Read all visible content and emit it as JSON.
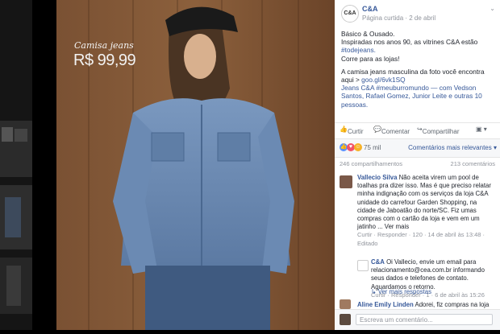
{
  "image_overlay": {
    "title": "Camisa jeans",
    "price": "R$ 99,99"
  },
  "post": {
    "page_name": "C&A",
    "page_logo_text": "C&A",
    "meta": "Página curtida · 2 de abril",
    "lines": [
      "Básico & Ousado.",
      "Inspiradas nos anos 90, as vitrines C&A estão",
      "#todejeans.",
      "Corre para as lojas!"
    ],
    "para2_prefix": "A camisa jeans masculina da foto você encontra",
    "para2_link_prefix": "aqui > ",
    "para2_link": "goo.gl/6vk1SQ",
    "tags_line1": "Jeans C&A #meuburromundo — com Vedson",
    "tags_line2": "Santos, Rafael Gomez, Junior Leite e outras 10",
    "tags_line3": "pessoas."
  },
  "actions": {
    "like": "Curtir",
    "comment": "Comentar",
    "share": "Compartilhar"
  },
  "reactions": {
    "count": "75 mil",
    "order_label": "Comentários mais relevantes ▾"
  },
  "stats": {
    "shares": "246 compartilhamentos",
    "comments": "213 comentários"
  },
  "comments": [
    {
      "name": "Vallecio Silva",
      "text": "Não aceita virem um pool de toalhas pra dizer isso. Mas é que preciso relatar minha indignação com os serviços da loja C&A unidade do carrefour Garden Shopping, na cidade de Jaboatão do norte/SC. Fiz umas compras com o cartão da loja e vem em um jatinho ... Ver mais",
      "meta": "Curtir · Responder · 120 · 14 de abril às 13:48 · Editado"
    },
    {
      "name": "C&A",
      "text": "Oi Vallecio, envie um email para relacionamento@cea.com.br informando seus dados e telefones de contato. Aguardamos o retorno.",
      "meta": "Curtir · Responder · 1 · 6 de abril às 15:26"
    },
    {
      "name": "Aline Emily Linden",
      "text": "Adorei, fiz compras na loja"
    }
  ],
  "more_replies": "Ver mais respostas",
  "write_placeholder": "Escreva um comentário..."
}
